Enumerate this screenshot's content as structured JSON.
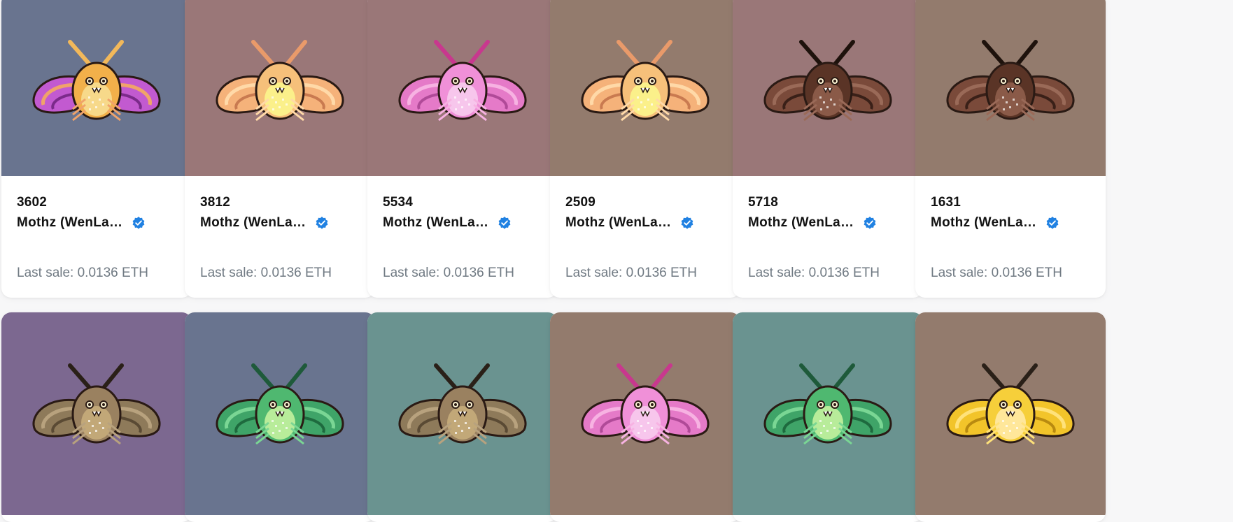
{
  "cards": [
    {
      "id": "3602",
      "collection": "Mothz (WenLambo)",
      "sale_label": "Last sale:",
      "sale_value": "0.0136 ETH",
      "bg": "#69748f",
      "moth": "purple"
    },
    {
      "id": "3812",
      "collection": "Mothz (WenLambo)",
      "sale_label": "Last sale:",
      "sale_value": "0.0136 ETH",
      "bg": "#9a7778",
      "moth": "peach"
    },
    {
      "id": "5534",
      "collection": "Mothz (WenLambo)",
      "sale_label": "Last sale:",
      "sale_value": "0.0136 ETH",
      "bg": "#9a7778",
      "moth": "pink"
    },
    {
      "id": "2509",
      "collection": "Mothz (WenLambo)",
      "sale_label": "Last sale:",
      "sale_value": "0.0136 ETH",
      "bg": "#937b6d",
      "moth": "peach"
    },
    {
      "id": "5718",
      "collection": "Mothz (WenLambo)",
      "sale_label": "Last sale:",
      "sale_value": "0.0136 ETH",
      "bg": "#9a7778",
      "moth": "dark"
    },
    {
      "id": "1631",
      "collection": "Mothz (WenLambo)",
      "sale_label": "Last sale:",
      "sale_value": "0.0136 ETH",
      "bg": "#937b6d",
      "moth": "dark"
    },
    {
      "bg": "#7c6890",
      "moth": "brown"
    },
    {
      "bg": "#69748f",
      "moth": "green"
    },
    {
      "bg": "#6a9390",
      "moth": "brown"
    },
    {
      "bg": "#937b6d",
      "moth": "pink"
    },
    {
      "bg": "#6a9390",
      "moth": "green"
    },
    {
      "bg": "#937b6d",
      "moth": "yellow"
    }
  ],
  "palettes": {
    "purple": {
      "wing": "#c25ad0",
      "wing_dark": "#7b2a8a",
      "wing_edge": "#f0a36a",
      "body": "#f2b04a",
      "belly": "#f7d98a",
      "ant": "#f2b85a"
    },
    "peach": {
      "wing": "#f5b27a",
      "wing_dark": "#c97a50",
      "wing_edge": "#ffd9a8",
      "body": "#f6c07a",
      "belly": "#fbf08a",
      "ant": "#e99a6a"
    },
    "pink": {
      "wing": "#e57ac8",
      "wing_dark": "#b04a98",
      "wing_edge": "#f7b2e2",
      "body": "#f090d8",
      "belly": "#f7c6ec",
      "ant": "#c8388e"
    },
    "dark": {
      "wing": "#7a4a3a",
      "wing_dark": "#3a2018",
      "wing_edge": "#9a6a58",
      "body": "#5a3426",
      "belly": "#8a5a48",
      "ant": "#1e120c"
    },
    "brown": {
      "wing": "#8e7a5a",
      "wing_dark": "#5a4a34",
      "wing_edge": "#b8a27e",
      "body": "#9a8160",
      "belly": "#c2a878",
      "ant": "#2a2018"
    },
    "green": {
      "wing": "#3fa468",
      "wing_dark": "#1e6a3e",
      "wing_edge": "#7ad694",
      "body": "#4fb870",
      "belly": "#b8ec9a",
      "ant": "#1e5a3a"
    },
    "yellow": {
      "wing": "#f2c42a",
      "wing_dark": "#b88a10",
      "wing_edge": "#ffe27a",
      "body": "#f6cf3a",
      "belly": "#ffe79a",
      "ant": "#2a2018"
    }
  }
}
